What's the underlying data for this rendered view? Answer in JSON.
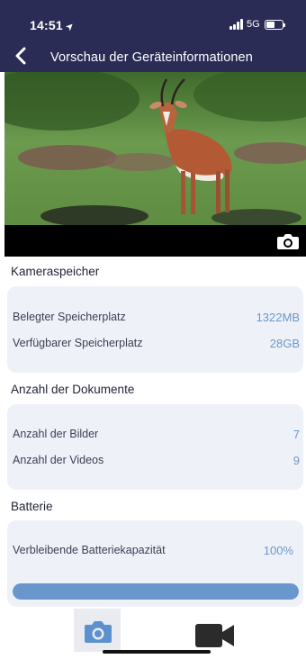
{
  "status_bar": {
    "time": "14:51",
    "network": "5G",
    "battery_level": 0.55
  },
  "header": {
    "title": "Vorschau der Geräteinformationen"
  },
  "icons": {
    "back": "chevron-left-icon",
    "snapshot": "camera-icon",
    "tab_photo": "camera-icon",
    "tab_video": "video-camera-icon",
    "location": "location-arrow-icon"
  },
  "storage": {
    "title": "Kameraspeicher",
    "rows": [
      {
        "label": "Belegter Speicherplatz",
        "value": "1322MB"
      },
      {
        "label": "Verfügbarer Speicherplatz",
        "value": "28GB"
      }
    ]
  },
  "documents": {
    "title": "Anzahl der Dokumente",
    "rows": [
      {
        "label": "Anzahl der Bilder",
        "value": "7"
      },
      {
        "label": "Anzahl der Videos",
        "value": "9"
      }
    ]
  },
  "battery": {
    "title": "Batterie",
    "label": "Verbleibende Batteriekapazität",
    "value": "100%",
    "level": 1.0
  },
  "colors": {
    "header_bg": "#2a2c55",
    "accent": "#6996cd",
    "value_text": "#6d97c8",
    "card_bg": "#eff1f8"
  }
}
